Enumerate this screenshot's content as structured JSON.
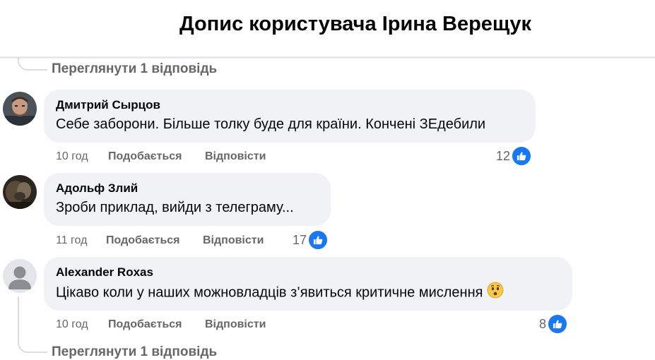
{
  "header": {
    "title": "Допис користувача Ірина Верещук"
  },
  "top_view_replies": "Переглянути 1 відповідь",
  "bottom_view_replies": "Переглянути 1 відповідь",
  "comments": [
    {
      "author": "Дмитрий Сырцов",
      "text": "Себе заборони. Більше толку буде для країни. Кончені ЗЕдебили",
      "time": "10 год",
      "like_label": "Подобається",
      "reply_label": "Відповісти",
      "reactions": "12",
      "reaction_icon": "like-icon"
    },
    {
      "author": "Адольф Злий",
      "text": "Зроби приклад, вийди з телеграму...",
      "time": "11 год",
      "like_label": "Подобається",
      "reply_label": "Відповісти",
      "reactions": "17",
      "reaction_icon": "like-icon"
    },
    {
      "author": "Alexander Roxas",
      "text": "Цікаво коли у наших можновладців з’явиться критичне мислення",
      "emoji": "worried-face-emoji",
      "time": "10 год",
      "like_label": "Подобається",
      "reply_label": "Відповісти",
      "reactions": "8",
      "reaction_icon": "like-icon"
    }
  ],
  "colors": {
    "bubble": "#f0f2f5",
    "secondary_text": "#65676b",
    "like_blue": "#1877f2",
    "thread_line": "#dadde1"
  }
}
